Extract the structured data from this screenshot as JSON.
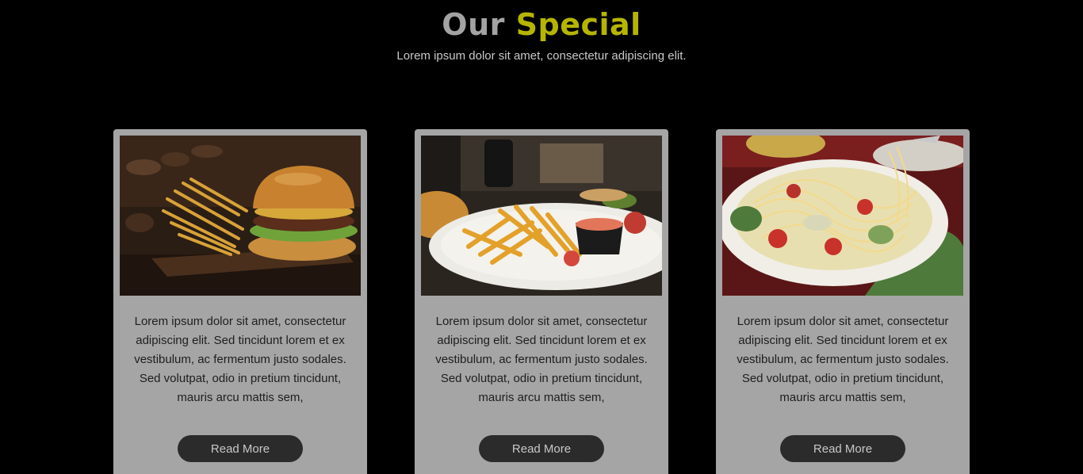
{
  "section": {
    "title_part1": "Our",
    "title_part2": "Special",
    "subtitle": "Lorem ipsum dolor sit amet, consectetur adipiscing elit."
  },
  "colors": {
    "background": "#000000",
    "title_gray": "#a3a3a3",
    "title_accent": "#b5b500",
    "card_bg": "#a5a5a5",
    "button_bg": "#2b2b2b"
  },
  "cards": [
    {
      "image": "burger-and-fries-photo",
      "text": "Lorem ipsum dolor sit amet, consectetur adipiscing elit. Sed tincidunt lorem et ex vestibulum, ac fermentum justo sodales. Sed volutpat, odio in pretium tincidunt, mauris arcu mattis sem,",
      "button_label": "Read More"
    },
    {
      "image": "fries-plate-photo",
      "text": "Lorem ipsum dolor sit amet, consectetur adipiscing elit. Sed tincidunt lorem et ex vestibulum, ac fermentum justo sodales. Sed volutpat, odio in pretium tincidunt, mauris arcu mattis sem,",
      "button_label": "Read More"
    },
    {
      "image": "spaghetti-plate-photo",
      "text": "Lorem ipsum dolor sit amet, consectetur adipiscing elit. Sed tincidunt lorem et ex vestibulum, ac fermentum justo sodales. Sed volutpat, odio in pretium tincidunt, mauris arcu mattis sem,",
      "button_label": "Read More"
    }
  ]
}
